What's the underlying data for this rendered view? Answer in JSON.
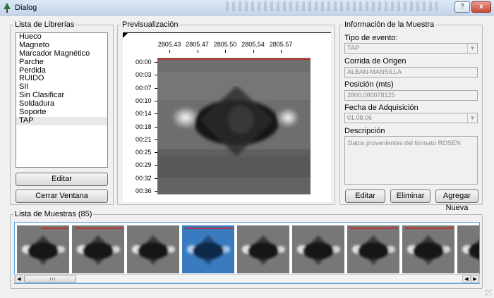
{
  "window": {
    "title": "Dialog",
    "help_glyph": "?",
    "close_glyph": "x"
  },
  "library": {
    "group_title": "Lista de Librerías",
    "items": [
      "Hueco",
      "Magneto",
      "Marcador Magnético",
      "Parche",
      "Perdida",
      "RUIDO",
      "SII",
      "Sin Clasificar",
      "Soldadura",
      "Soporte",
      "TAP"
    ],
    "selected_index": 10,
    "edit_label": "Editar",
    "close_label": "Cerrar Ventana"
  },
  "preview": {
    "group_title": "Previsualización",
    "x_ticks": [
      "2805.43",
      "2805.47",
      "2805.50",
      "2805.54",
      "2805.57"
    ],
    "y_ticks": [
      "00:00",
      "00:03",
      "00:07",
      "00:10",
      "00:14",
      "00:18",
      "00:21",
      "00:25",
      "00:29",
      "00:32",
      "00:36"
    ],
    "trace_color": "#cc2020"
  },
  "sample_info": {
    "group_title": "Información de la Muestra",
    "event_type_label": "Tipo de evento:",
    "event_type_value": "TAP",
    "origin_run_label": "Corrida de Origen",
    "origin_run_value": "ALBAN-MANSILLA",
    "position_label": "Posición (mts)",
    "position_value": "2800,080078125",
    "acquisition_date_label": "Fecha de Adquisición",
    "acquisition_date_value": "01.08.06",
    "description_label": "Descripción",
    "description_value": "Datos provenientes del formato ROSEN",
    "edit_label": "Editar",
    "delete_label": "Eliminar",
    "add_new_label": "Agregar Nueva"
  },
  "samples": {
    "group_title": "Lista de Muestras (85)",
    "thumbnails": [
      {
        "red_line": true,
        "selected": false
      },
      {
        "red_line": true,
        "selected": false
      },
      {
        "red_line": false,
        "selected": false
      },
      {
        "red_line": true,
        "selected": true
      },
      {
        "red_line": false,
        "selected": false
      },
      {
        "red_line": false,
        "selected": false
      },
      {
        "red_line": true,
        "selected": false
      },
      {
        "red_line": true,
        "selected": false
      },
      {
        "red_line": false,
        "selected": false
      }
    ]
  },
  "icons": {
    "app": "tree-icon",
    "scroll_left": "arrow-left-icon",
    "scroll_right": "arrow-right-icon",
    "combo": "chevron-down-icon"
  },
  "colors": {
    "selection": "#3d8ee0",
    "accent_border": "#5aa0e0"
  }
}
